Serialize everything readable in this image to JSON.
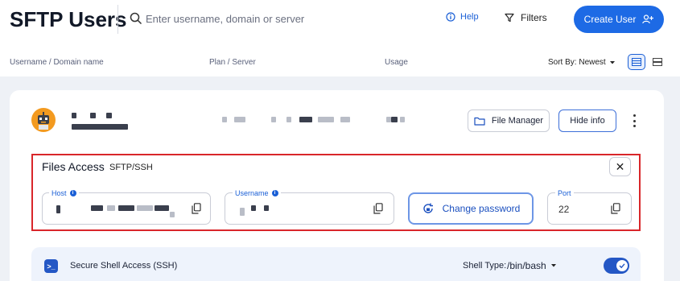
{
  "header": {
    "title": "SFTP Users",
    "search_placeholder": "Enter username, domain or server",
    "help_label": "Help",
    "filters_label": "Filters",
    "create_user_label": "Create User"
  },
  "columns": {
    "username": "Username / Domain name",
    "plan": "Plan / Server",
    "usage": "Usage",
    "sort_label": "Sort By: Newest"
  },
  "user_card": {
    "file_manager_label": "File Manager",
    "hide_info_label": "Hide info"
  },
  "files_access": {
    "title": "Files Access",
    "protocol": "SFTP/SSH",
    "close_glyph": "✕",
    "host_label": "Host",
    "username_label": "Username",
    "change_password_label": "Change password",
    "port_label": "Port",
    "port_value": "22"
  },
  "ssh": {
    "label": "Secure Shell Access (SSH)",
    "shell_type_label": "Shell Type:",
    "shell_type_value": "/bin/bash",
    "enabled": true
  },
  "colors": {
    "accent": "#1d6ae5",
    "highlight_border": "#d9262a",
    "avatar": "#f39a1f"
  }
}
